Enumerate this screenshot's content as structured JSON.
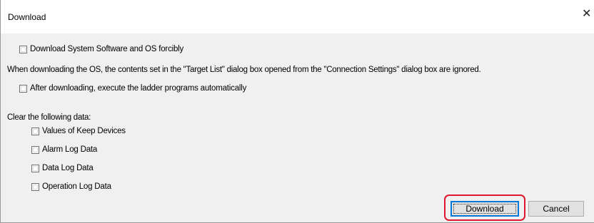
{
  "dialog": {
    "title": "Download",
    "close_glyph": "✕"
  },
  "options": {
    "force_download_label": "Download System Software and OS forcibly",
    "note_text": "When downloading the OS, the contents set in the \"Target List\" dialog box opened from the \"Connection Settings\" dialog box are ignored.",
    "run_after_label": "After downloading, execute the ladder programs automatically"
  },
  "clear": {
    "heading": "Clear the following data:",
    "items": [
      "Values of Keep Devices",
      "Alarm Log Data",
      "Data Log Data",
      "Operation Log Data"
    ]
  },
  "buttons": {
    "download": "Download",
    "cancel": "Cancel"
  },
  "colors": {
    "highlight": "#e0182f",
    "default_button_border": "#0078d7"
  }
}
